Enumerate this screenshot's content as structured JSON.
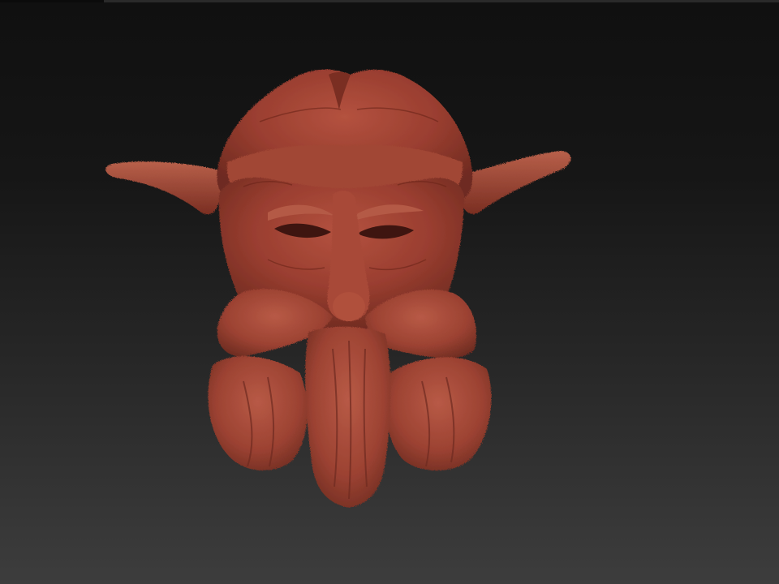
{
  "canvas": {
    "background_top": "#101010",
    "background_bottom": "#3d3d3d"
  },
  "model": {
    "material_color": "#9a3e30",
    "shadow_color": "#5a2018",
    "highlight_color": "#c8705a"
  }
}
